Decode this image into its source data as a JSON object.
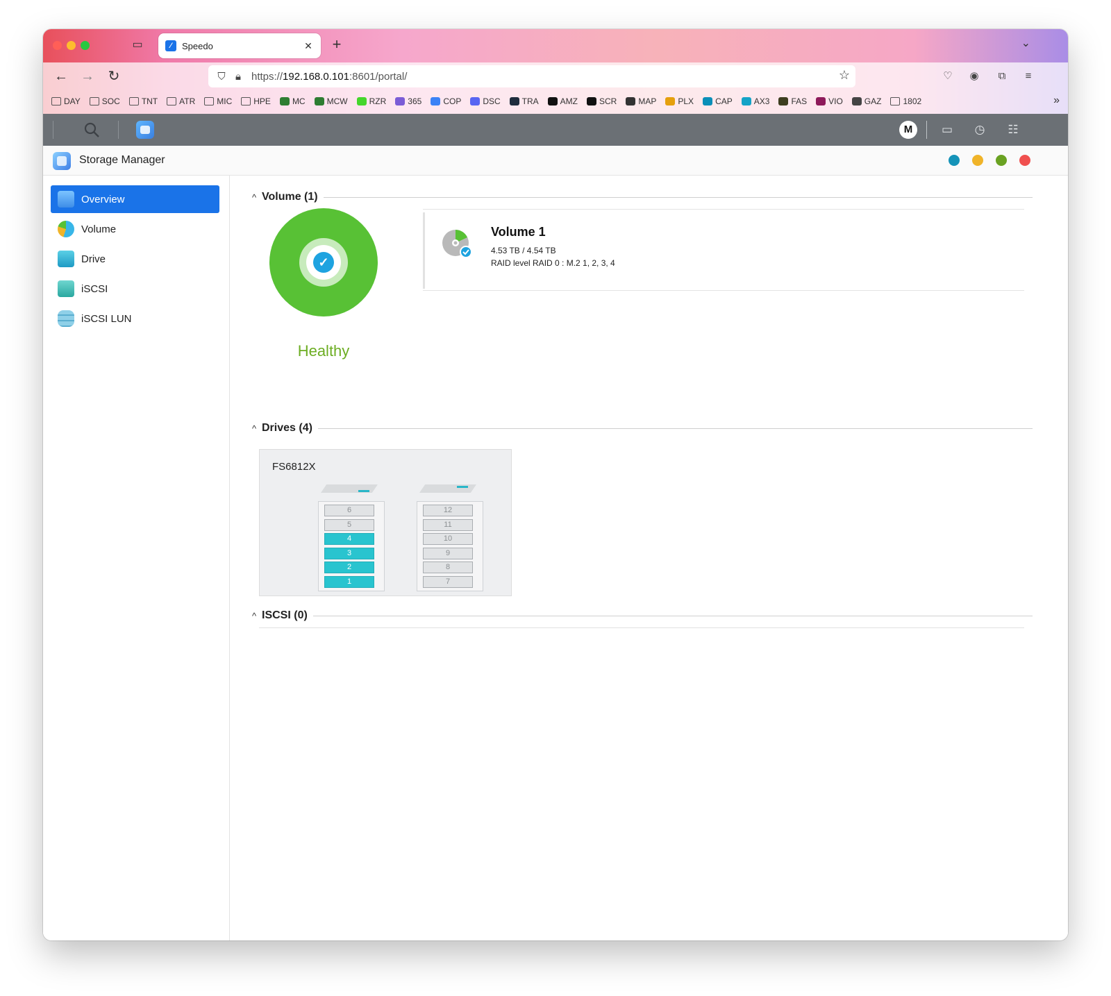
{
  "browser": {
    "tab_title": "Speedo",
    "url_prefix": "https://",
    "url_host": "192.168.0.101",
    "url_rest": ":8601/portal/",
    "bookmarks": [
      {
        "label": "DAY",
        "icon": "folder-icon"
      },
      {
        "label": "SOC",
        "icon": "folder-icon"
      },
      {
        "label": "TNT",
        "icon": "folder-icon"
      },
      {
        "label": "ATR",
        "icon": "folder-icon"
      },
      {
        "label": "MIC",
        "icon": "folder-icon"
      },
      {
        "label": "HPE",
        "icon": "folder-icon"
      },
      {
        "label": "MC",
        "icon": "mc-icon",
        "color": "#2e7d32"
      },
      {
        "label": "MCW",
        "icon": "mcw-icon",
        "color": "#2e7d32"
      },
      {
        "label": "RZR",
        "icon": "razer-icon",
        "color": "#44d62c"
      },
      {
        "label": "365",
        "icon": "m365-icon",
        "color": "#7b5cd6"
      },
      {
        "label": "COP",
        "icon": "copilot-icon",
        "color": "#3b82f6"
      },
      {
        "label": "DSC",
        "icon": "discord-icon",
        "color": "#5865f2"
      },
      {
        "label": "TRA",
        "icon": "tra-icon",
        "color": "#1f2d3d"
      },
      {
        "label": "AMZ",
        "icon": "amazon-icon",
        "color": "#111111"
      },
      {
        "label": "SCR",
        "icon": "scr-icon",
        "color": "#111111"
      },
      {
        "label": "MAP",
        "icon": "globe-icon",
        "color": "#333333"
      },
      {
        "label": "PLX",
        "icon": "plex-icon",
        "color": "#e5a00d"
      },
      {
        "label": "CAP",
        "icon": "cap-icon",
        "color": "#0a8fb8"
      },
      {
        "label": "AX3",
        "icon": "ax3-icon",
        "color": "#14a3c7"
      },
      {
        "label": "FAS",
        "icon": "fas-icon",
        "color": "#3d3d1f"
      },
      {
        "label": "VIO",
        "icon": "vio-icon",
        "color": "#8e1a5a"
      },
      {
        "label": "GAZ",
        "icon": "gaz-icon",
        "color": "#444444"
      },
      {
        "label": "1802",
        "icon": "folder-icon"
      }
    ]
  },
  "app_toolbar": {
    "avatar_letter": "M"
  },
  "window": {
    "title": "Storage Manager",
    "dots": [
      "#1593b8",
      "#f0b429",
      "#6aa222",
      "#f0504f"
    ]
  },
  "sidebar": {
    "items": [
      {
        "label": "Overview",
        "active": true
      },
      {
        "label": "Volume",
        "active": false
      },
      {
        "label": "Drive",
        "active": false
      },
      {
        "label": "iSCSI",
        "active": false
      },
      {
        "label": "iSCSI LUN",
        "active": false
      }
    ]
  },
  "sections": {
    "volume": {
      "title": "Volume (1)"
    },
    "drives": {
      "title": "Drives (4)"
    },
    "iscsi": {
      "title": "ISCSI (0)"
    }
  },
  "health": {
    "status": "Healthy",
    "color": "#58c135"
  },
  "volume_card": {
    "name": "Volume 1",
    "capacity": "4.53 TB / 4.54 TB",
    "raid": "RAID level RAID 0 : M.2 1, 2, 3, 4"
  },
  "drives": {
    "model": "FS6812X",
    "enclosures": [
      {
        "bays": [
          {
            "n": "6",
            "in_use": false
          },
          {
            "n": "5",
            "in_use": false
          },
          {
            "n": "4",
            "in_use": true
          },
          {
            "n": "3",
            "in_use": true
          },
          {
            "n": "2",
            "in_use": true
          },
          {
            "n": "1",
            "in_use": true
          }
        ]
      },
      {
        "bays": [
          {
            "n": "12",
            "in_use": false
          },
          {
            "n": "11",
            "in_use": false
          },
          {
            "n": "10",
            "in_use": false
          },
          {
            "n": "9",
            "in_use": false
          },
          {
            "n": "8",
            "in_use": false
          },
          {
            "n": "7",
            "in_use": false
          }
        ]
      }
    ]
  }
}
